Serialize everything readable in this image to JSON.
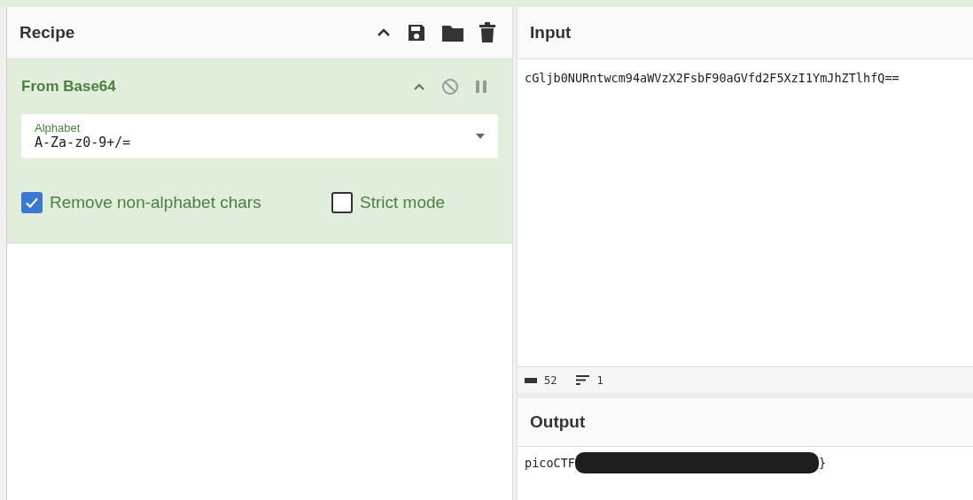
{
  "recipe": {
    "title": "Recipe",
    "operations": [
      {
        "title": "From Base64",
        "field": {
          "label": "Alphabet",
          "value": "A-Za-z0-9+/="
        },
        "options": [
          {
            "label": "Remove non-alphabet chars",
            "checked": true
          },
          {
            "label": "Strict mode",
            "checked": false
          }
        ]
      }
    ]
  },
  "input": {
    "title": "Input",
    "value": "cGljb0NURntwcm94aWVzX2FsbF90aGVfd2F5XzI1YmJhZTlhfQ==",
    "status": {
      "length": "52",
      "lines": "1"
    }
  },
  "output": {
    "title": "Output",
    "value_before": "picoCTF",
    "value_after": "}",
    "redacted": true
  }
}
